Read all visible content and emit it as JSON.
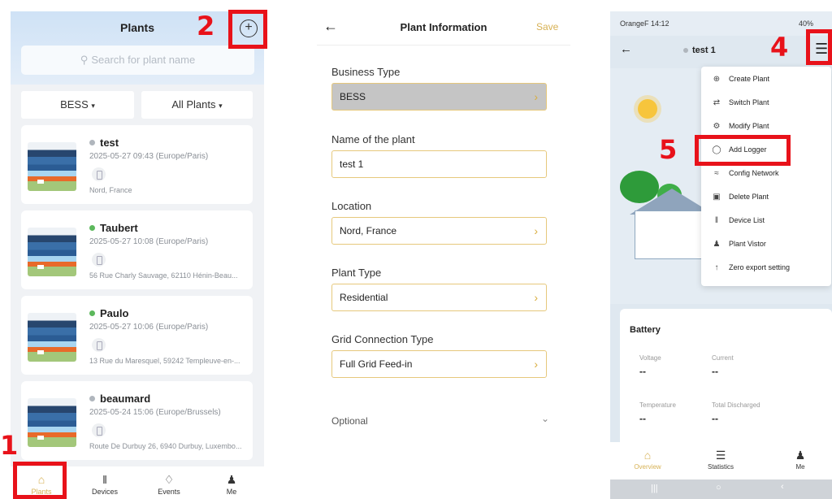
{
  "markers": [
    "1",
    "2",
    "4",
    "5"
  ],
  "plants_screen": {
    "title": "Plants",
    "search_placeholder": "Search for plant name",
    "filter_type": "BESS",
    "filter_scope": "All Plants",
    "plants": [
      {
        "name": "test",
        "status": "offline",
        "date": "2025-05-27 09:43 (Europe/Paris)",
        "address": "Nord, France"
      },
      {
        "name": "Taubert",
        "status": "online",
        "date": "2025-05-27 10:08 (Europe/Paris)",
        "address": "56 Rue Charly Sauvage, 62110 Hénin-Beau..."
      },
      {
        "name": "Paulo",
        "status": "online",
        "date": "2025-05-27 10:06 (Europe/Paris)",
        "address": "13 Rue du Maresquel, 59242 Templeuve-en-..."
      },
      {
        "name": "beaumard",
        "status": "offline",
        "date": "2025-05-24 15:06 (Europe/Brussels)",
        "address": "Route De Durbuy 26, 6940 Durbuy, Luxembo..."
      }
    ],
    "tabs": [
      {
        "label": "Plants",
        "icon": "home-icon",
        "active": true
      },
      {
        "label": "Devices",
        "icon": "devices-icon",
        "active": false
      },
      {
        "label": "Events",
        "icon": "bell-icon",
        "active": false
      },
      {
        "label": "Me",
        "icon": "user-icon",
        "active": false
      }
    ]
  },
  "plant_info_screen": {
    "title": "Plant Information",
    "save_label": "Save",
    "fields": [
      {
        "label": "Business Type",
        "value": "BESS",
        "disabled": true
      },
      {
        "label": "Name of the plant",
        "value": "test 1",
        "disabled": false
      },
      {
        "label": "Location",
        "value": "Nord, France",
        "disabled": false
      },
      {
        "label": "Plant Type",
        "value": "Residential",
        "disabled": false
      },
      {
        "label": "Grid Connection Type",
        "value": "Full Grid Feed-in",
        "disabled": false
      }
    ],
    "optional_label": "Optional"
  },
  "overview_screen": {
    "status_carrier_time": "OrangeF 14:12",
    "status_battery": "40%",
    "plant_name": "test 1",
    "menu_items": [
      {
        "label": "Create Plant",
        "icon": "plus-circle-icon"
      },
      {
        "label": "Switch Plant",
        "icon": "switch-icon"
      },
      {
        "label": "Modify Plant",
        "icon": "settings-icon"
      },
      {
        "label": "Add Logger",
        "icon": "logger-icon"
      },
      {
        "label": "Config Network",
        "icon": "wifi-icon"
      },
      {
        "label": "Delete Plant",
        "icon": "trash-icon"
      },
      {
        "label": "Device List",
        "icon": "device-list-icon"
      },
      {
        "label": "Plant Vistor",
        "icon": "visitor-icon"
      },
      {
        "label": "Zero export setting",
        "icon": "zero-export-icon"
      }
    ],
    "battery": {
      "title": "Battery",
      "voltage_label": "Voltage",
      "voltage_value": "--",
      "current_label": "Current",
      "current_value": "--",
      "temperature_label": "Temperature",
      "temperature_value": "--",
      "discharged_label": "Total Discharged",
      "discharged_value": "--"
    },
    "tabs": [
      {
        "label": "Overview",
        "icon": "home-icon",
        "active": true
      },
      {
        "label": "Statistics",
        "icon": "statistics-icon",
        "active": false
      },
      {
        "label": "Me",
        "icon": "user-icon",
        "active": false
      }
    ]
  },
  "colors": {
    "marker_red": "#e8121a",
    "accent_gold": "#d7b154",
    "online_green": "#5cb85c",
    "offline_gray": "#b0b6bd"
  }
}
